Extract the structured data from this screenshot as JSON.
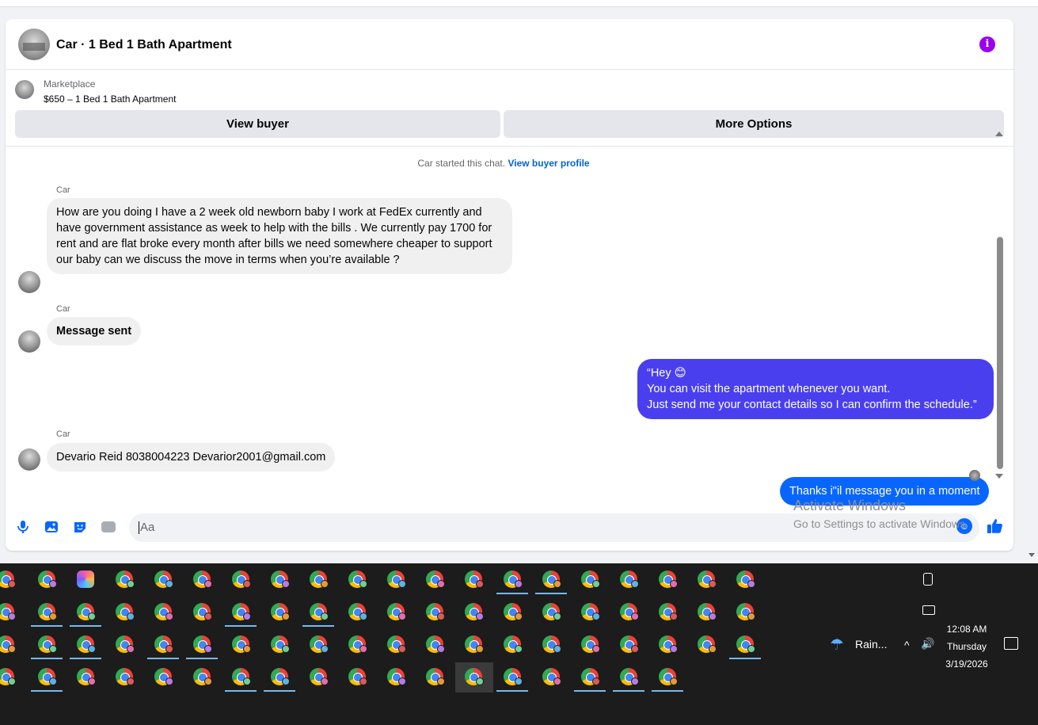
{
  "header": {
    "title": "Car · 1 Bed 1 Bath Apartment",
    "info_glyph": "i"
  },
  "listing": {
    "source": "Marketplace",
    "name": "$650 – 1 Bed 1 Bath Apartment",
    "view_buyer_label": "View buyer",
    "more_options_label": "More Options"
  },
  "chat": {
    "started_text": "Car started this chat.",
    "started_link": "View buyer profile",
    "messages": [
      {
        "sender": "Car",
        "text": "How are you doing I have a 2 week old newborn baby I work at FedEx currently and have government assistance as week to help with the bills . We currently pay 1700 for rent and are flat broke every month after bills we need somewhere cheaper to support our baby can we discuss the move in terms when you’re available ?"
      },
      {
        "sender": "Car",
        "text": "Message sent"
      },
      {
        "sender": "",
        "text_lines": [
          "“Hey 😊",
          "You can visit the apartment whenever you want.",
          "Just send me your contact details so I can confirm the schedule.”"
        ]
      },
      {
        "sender": "Car",
        "text": "Devario Reid 8038004223 Devarior2001@gmail.com"
      },
      {
        "sender": "",
        "text": "Thanks i\"il message you in a moment"
      }
    ]
  },
  "composer": {
    "placeholder": "Aa",
    "gif_label": "GIF"
  },
  "watermark": {
    "line1": "Activate Windows",
    "line2": "Go to Settings to activate Windows."
  },
  "taskbar": {
    "weather": "Rain...",
    "time": "12:08 AM",
    "day": "Thursday",
    "date": "3/19/2026"
  },
  "colors": {
    "outgoing_purple": "#4a3fef",
    "outgoing_blue": "#0866ff",
    "accent_purple": "#9b00f0",
    "link_blue": "#0064d1"
  }
}
